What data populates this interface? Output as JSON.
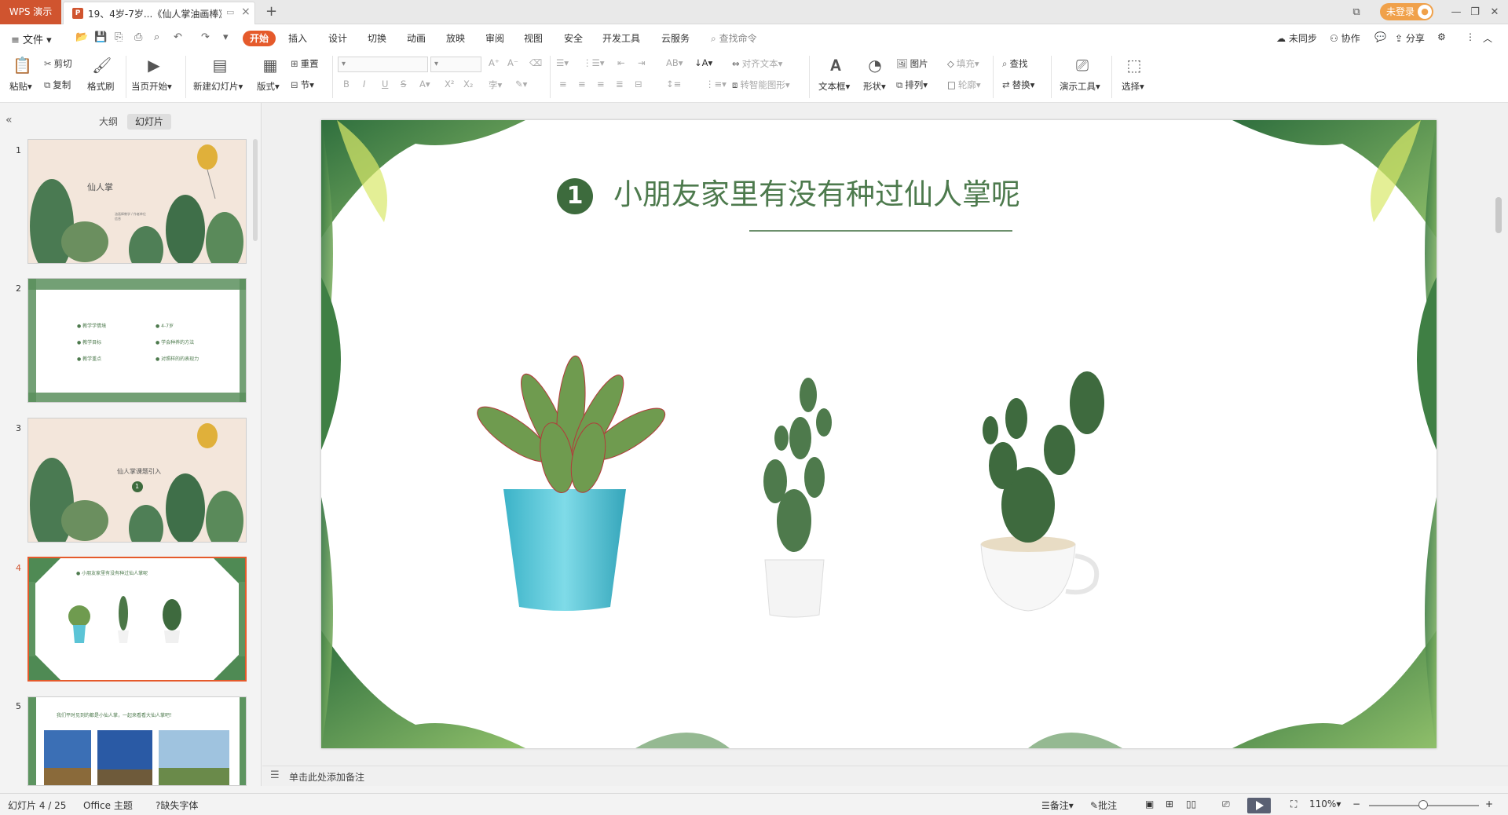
{
  "titlebar": {
    "app_name": "WPS 演示",
    "doc_title": "19、4岁-7岁...《仙人掌油画棒》",
    "login_label": "未登录",
    "icons": [
      "panel-layout-icon",
      "minimize-icon",
      "restore-icon",
      "close-icon"
    ]
  },
  "menubar": {
    "file_label": "文件",
    "tabs": [
      "开始",
      "插入",
      "设计",
      "切换",
      "动画",
      "放映",
      "审阅",
      "视图",
      "安全",
      "开发工具",
      "云服务"
    ],
    "active_tab": "开始",
    "search_label": "查找命令",
    "sync_label": "未同步",
    "collab_label": "协作",
    "share_label": "分享"
  },
  "ribbon": {
    "paste": "粘贴",
    "cut": "剪切",
    "copy": "复制",
    "format_painter": "格式刷",
    "play_from_current": "当页开始",
    "new_slide": "新建幻灯片",
    "layout": "版式",
    "reset": "重置",
    "section": "节",
    "align_text": "对齐文本",
    "smartart": "转智能图形",
    "textbox": "文本框",
    "shape": "形状",
    "picture": "图片",
    "fill": "填充",
    "arrange": "排列",
    "outline": "轮廓",
    "find": "查找",
    "replace": "替换",
    "presentation_tools": "演示工具",
    "select": "选择"
  },
  "panel": {
    "tab_outline": "大纲",
    "tab_slides": "幻灯片",
    "thumbs": [
      {
        "num": "1",
        "title": "仙人掌",
        "sub": "油画棒教学 / 作者单位信息"
      },
      {
        "num": "2",
        "items_left": [
          "教学学情境",
          "教学目标",
          "教学重点"
        ],
        "items_right": [
          "4-7岁",
          "学会种养的方法",
          "对照样的的表现力"
        ]
      },
      {
        "num": "3",
        "title": "仙人掌课题引入",
        "badge": "1"
      },
      {
        "num": "4",
        "title": "小朋友家里有没有种过仙人掌呢",
        "badge": "1"
      },
      {
        "num": "5",
        "title": "我们平时见到的都是小仙人掌，一起来看看大仙人掌吧！"
      }
    ],
    "current": "4"
  },
  "slide": {
    "badge": "1",
    "title": "小朋友家里有没有种过仙人掌呢",
    "title_color": "#4d7a4d",
    "badge_color": "#3d6b3d"
  },
  "notes": {
    "placeholder": "单击此处添加备注"
  },
  "statusbar": {
    "slide_counter": "幻灯片 4 / 25",
    "theme": "Office 主题",
    "missing_font": "缺失字体",
    "notes_label": "备注",
    "comments_label": "批注",
    "zoom": "110%"
  }
}
